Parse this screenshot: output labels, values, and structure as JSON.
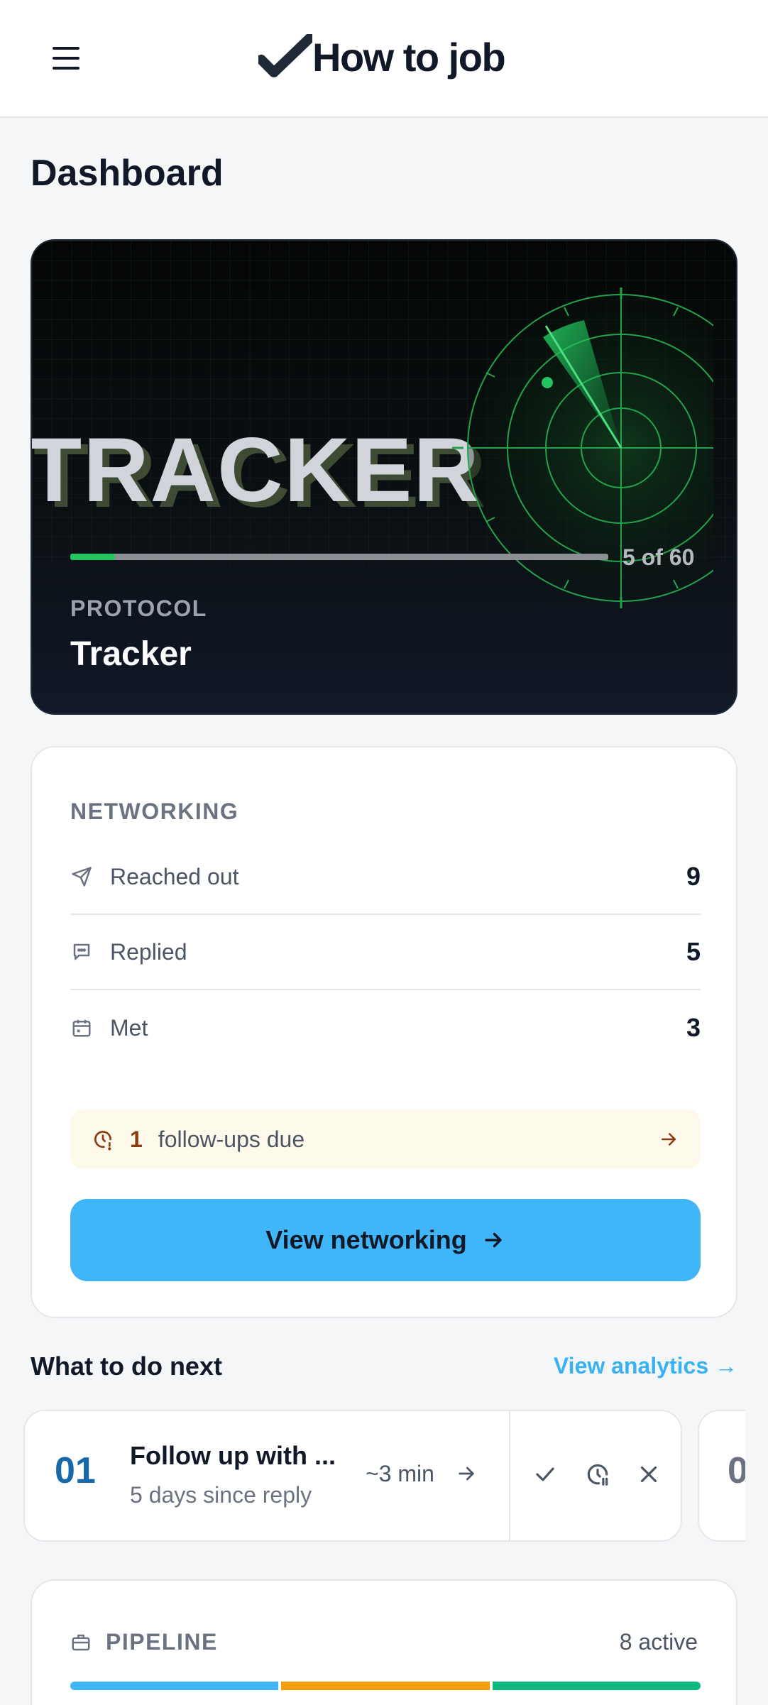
{
  "header": {
    "logo_text": "How to job",
    "menu_icon": "hamburger-menu-icon",
    "logo_icon": "checkmark-icon"
  },
  "page": {
    "title": "Dashboard"
  },
  "tracker": {
    "banner_word": "TRACKER",
    "progress_text": "5 of 60",
    "progress_value": 5,
    "progress_total": 60,
    "label": "PROTOCOL",
    "title": "Tracker",
    "accent": "#22c55e"
  },
  "networking": {
    "title": "NETWORKING",
    "rows": [
      {
        "icon": "send-icon",
        "label": "Reached out",
        "value": "9"
      },
      {
        "icon": "chat-icon",
        "label": "Replied",
        "value": "5"
      },
      {
        "icon": "calendar-icon",
        "label": "Met",
        "value": "3"
      }
    ],
    "followups": {
      "count": "1",
      "text": "follow-ups due",
      "icon": "clock-alert-icon"
    },
    "button_label": "View networking"
  },
  "next": {
    "title": "What to do next",
    "analytics_link": "View analytics →",
    "tasks": [
      {
        "number": "01",
        "title": "Follow up with ...",
        "subtitle": "5 days since reply",
        "time": "~3 min"
      }
    ],
    "peek_number": "0"
  },
  "pipeline": {
    "title": "PIPELINE",
    "active_text": "8 active",
    "segment_colors": [
      "#40b5f7",
      "#f59e0b",
      "#10b981"
    ]
  }
}
